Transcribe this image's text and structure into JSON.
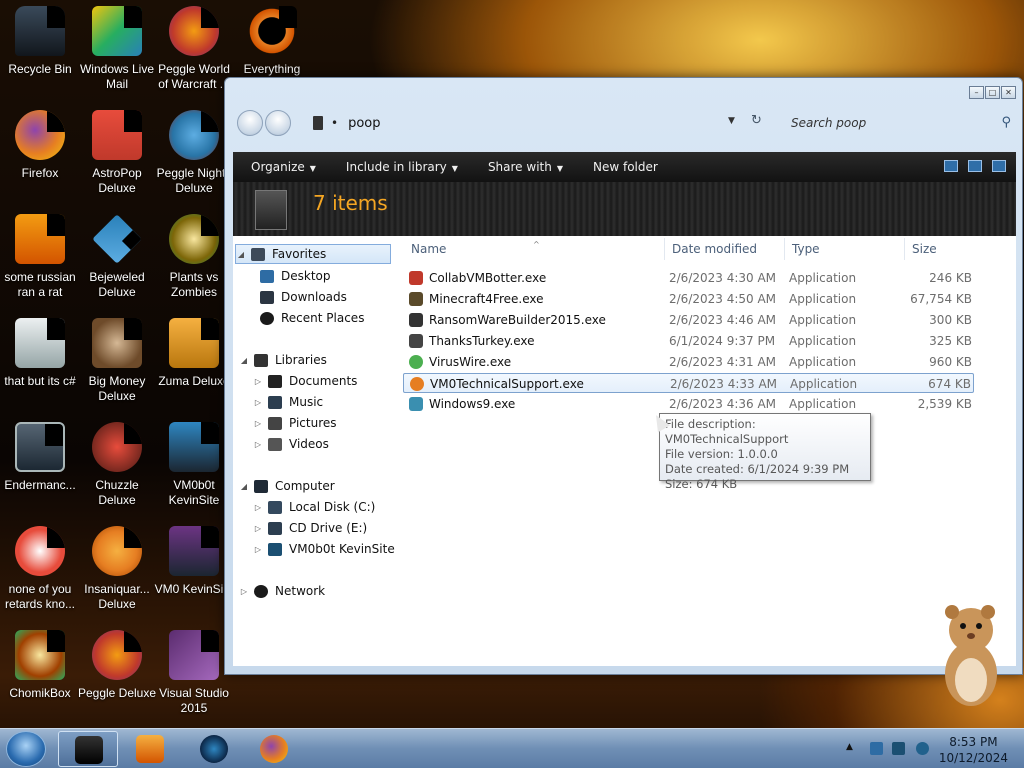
{
  "desktop": {
    "icons": [
      {
        "label": "Recycle Bin"
      },
      {
        "label": "Windows Live Mail"
      },
      {
        "label": "Peggle World of Warcraft ..."
      },
      {
        "label": "Everything"
      },
      {
        "label": "Firefox"
      },
      {
        "label": "AstroPop Deluxe"
      },
      {
        "label": "Peggle Nights Deluxe"
      },
      {
        "label": "some russian ran a rat"
      },
      {
        "label": "Bejeweled Deluxe"
      },
      {
        "label": "Plants vs Zombies"
      },
      {
        "label": "that but its c#"
      },
      {
        "label": "Big Money Deluxe"
      },
      {
        "label": "Zuma Deluxe"
      },
      {
        "label": "Endermanc..."
      },
      {
        "label": "Chuzzle Deluxe"
      },
      {
        "label": "VM0b0t KevinSite"
      },
      {
        "label": "none of you retards kno..."
      },
      {
        "label": "Insaniquar... Deluxe"
      },
      {
        "label": "VM0 KevinSi..."
      },
      {
        "label": "ChomikBox"
      },
      {
        "label": "Peggle Deluxe"
      },
      {
        "label": "Visual Studio 2015"
      }
    ]
  },
  "explorer": {
    "address": {
      "path": "poop"
    },
    "search": {
      "placeholder": "Search poop"
    },
    "toolbar": {
      "organize": "Organize",
      "include": "Include in library",
      "share": "Share with",
      "new_folder": "New folder"
    },
    "item_count": "7 items",
    "nav": {
      "favorites": "Favorites",
      "desktop": "Desktop",
      "downloads": "Downloads",
      "recent": "Recent Places",
      "libraries": "Libraries",
      "documents": "Documents",
      "music": "Music",
      "pictures": "Pictures",
      "videos": "Videos",
      "computer": "Computer",
      "local_disk": "Local Disk (C:)",
      "cd_drive": "CD Drive (E:)",
      "kevinsite": "VM0b0t KevinSite",
      "network": "Network"
    },
    "columns": {
      "name": "Name",
      "date": "Date modified",
      "type": "Type",
      "size": "Size"
    },
    "files": [
      {
        "name": "CollabVMBotter.exe",
        "date": "2/6/2023 4:30 AM",
        "type": "Application",
        "size": "246 KB",
        "color": "#c0392b"
      },
      {
        "name": "Minecraft4Free.exe",
        "date": "2/6/2023 4:50 AM",
        "type": "Application",
        "size": "67,754 KB",
        "color": "#5a4a2a"
      },
      {
        "name": "RansomWareBuilder2015.exe",
        "date": "2/6/2023 4:46 AM",
        "type": "Application",
        "size": "300 KB",
        "color": "#333333"
      },
      {
        "name": "ThanksTurkey.exe",
        "date": "6/1/2024 9:37 PM",
        "type": "Application",
        "size": "325 KB",
        "color": "#444444"
      },
      {
        "name": "VirusWire.exe",
        "date": "2/6/2023 4:31 AM",
        "type": "Application",
        "size": "960 KB",
        "color": "#4caf50"
      },
      {
        "name": "VM0TechnicalSupport.exe",
        "date": "2/6/2023 4:33 AM",
        "type": "Application",
        "size": "674 KB",
        "color": "#e67e22"
      },
      {
        "name": "Windows9.exe",
        "date": "2/6/2023 4:36 AM",
        "type": "Application",
        "size": "2,539 KB",
        "color": "#3a8fb0"
      }
    ],
    "tooltip": {
      "description": "File description: VM0TechnicalSupport",
      "version": "File version: 1.0.0.0",
      "created": "Date created: 6/1/2024 9:39 PM",
      "size": "Size: 674 KB"
    }
  },
  "taskbar": {
    "time": "8:53 PM",
    "date": "10/12/2024"
  }
}
